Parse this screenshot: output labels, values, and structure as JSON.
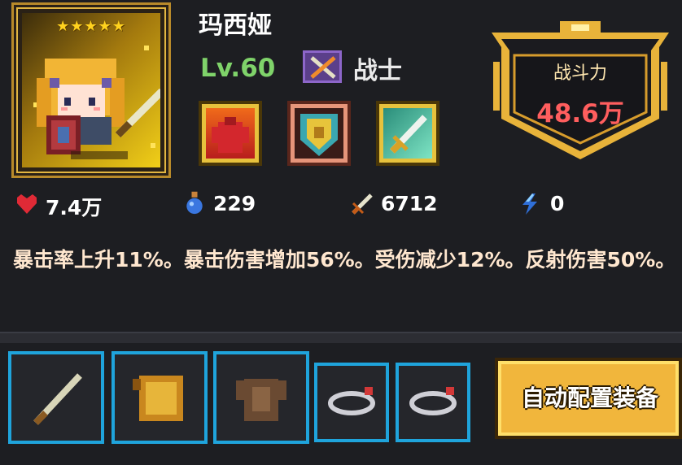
{
  "character": {
    "name": "玛西娅",
    "stars": "★★★★★",
    "level": "Lv.60",
    "class": "战士"
  },
  "power": {
    "label": "战斗力",
    "value": "48.6万"
  },
  "stats": {
    "hp": "7.4万",
    "mana": "229",
    "attack": "6712",
    "speed": "0"
  },
  "description": "暴击率上升11%。暴击伤害增加56%。受伤减少12%。反射伤害50%。",
  "buttons": {
    "auto_equip": "自动配置装备"
  },
  "icons": {
    "class": "crossed-swords-icon",
    "skill_1": "armor-icon",
    "skill_2": "shield-icon",
    "skill_3": "sword-icon",
    "hp": "heart-icon",
    "mana": "potion-icon",
    "attack": "sword-icon",
    "speed": "lightning-icon",
    "slot_1": "sword-icon",
    "slot_2": "book-icon",
    "slot_3": "armor-icon",
    "slot_4": "ring-icon",
    "slot_5": "ring-icon"
  },
  "colors": {
    "level": "#7fd36a",
    "power_value": "#ff5e5e",
    "slot_border": "#1fa4dc",
    "button_bg": "#f1b63c"
  }
}
